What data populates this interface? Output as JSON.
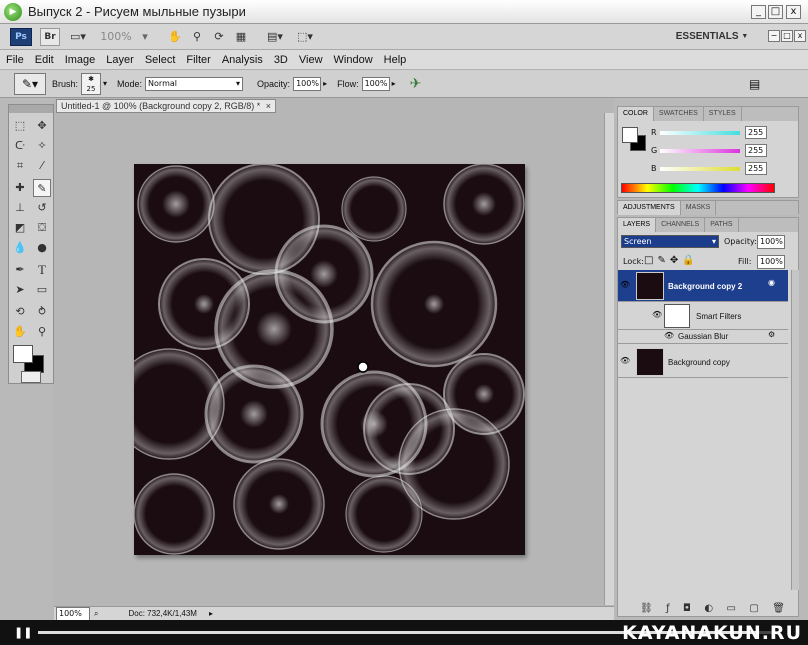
{
  "window": {
    "title": "Выпуск 2 - Рисуем мыльные пузыри",
    "min": "_",
    "max": "□",
    "close": "x"
  },
  "appbar": {
    "logo": "Ps",
    "br": "Br",
    "zoom": "100%",
    "workspace": "ESSENTIALS",
    "workspace_arrow": "▼",
    "win_min": "−",
    "win_max": "□",
    "win_close": "x"
  },
  "menu": [
    "File",
    "Edit",
    "Image",
    "Layer",
    "Select",
    "Filter",
    "Analysis",
    "3D",
    "View",
    "Window",
    "Help"
  ],
  "options": {
    "brush_label": "Brush:",
    "brush_size": "25",
    "mode_label": "Mode:",
    "mode_value": "Normal",
    "opacity_label": "Opacity:",
    "opacity_value": "100%",
    "flow_label": "Flow:",
    "flow_value": "100%"
  },
  "document": {
    "tab_title": "Untitled-1 @ 100% (Background copy 2, RGB/8) *",
    "tab_close": "×"
  },
  "status": {
    "zoom": "100%",
    "doc_info": "Doc: 732,4K/1,43M"
  },
  "color_panel": {
    "tabs": [
      "COLOR",
      "SWATCHES",
      "STYLES"
    ],
    "channels": [
      {
        "label": "R",
        "value": "255",
        "color": "#44dede"
      },
      {
        "label": "G",
        "value": "255",
        "color": "#dd33dd"
      },
      {
        "label": "B",
        "value": "255",
        "color": "#dddd33"
      }
    ]
  },
  "adjust_panel": {
    "tabs": [
      "ADJUSTMENTS",
      "MASKS"
    ]
  },
  "layers_panel": {
    "tabs": [
      "LAYERS",
      "CHANNELS",
      "PATHS"
    ],
    "blend_mode": "Screen",
    "opacity_label": "Opacity:",
    "opacity_value": "100%",
    "lock_label": "Lock:",
    "fill_label": "Fill:",
    "fill_value": "100%",
    "layers": [
      {
        "name": "Background copy 2",
        "selected": true
      },
      {
        "name": "Smart Filters",
        "selected": false
      },
      {
        "name": "Gaussian Blur",
        "selected": false
      },
      {
        "name": "Background copy",
        "selected": false
      }
    ]
  },
  "player": {
    "play_icon": "pause-icon",
    "progress": 0.97,
    "watermark": "KAYANAKUN.RU"
  }
}
